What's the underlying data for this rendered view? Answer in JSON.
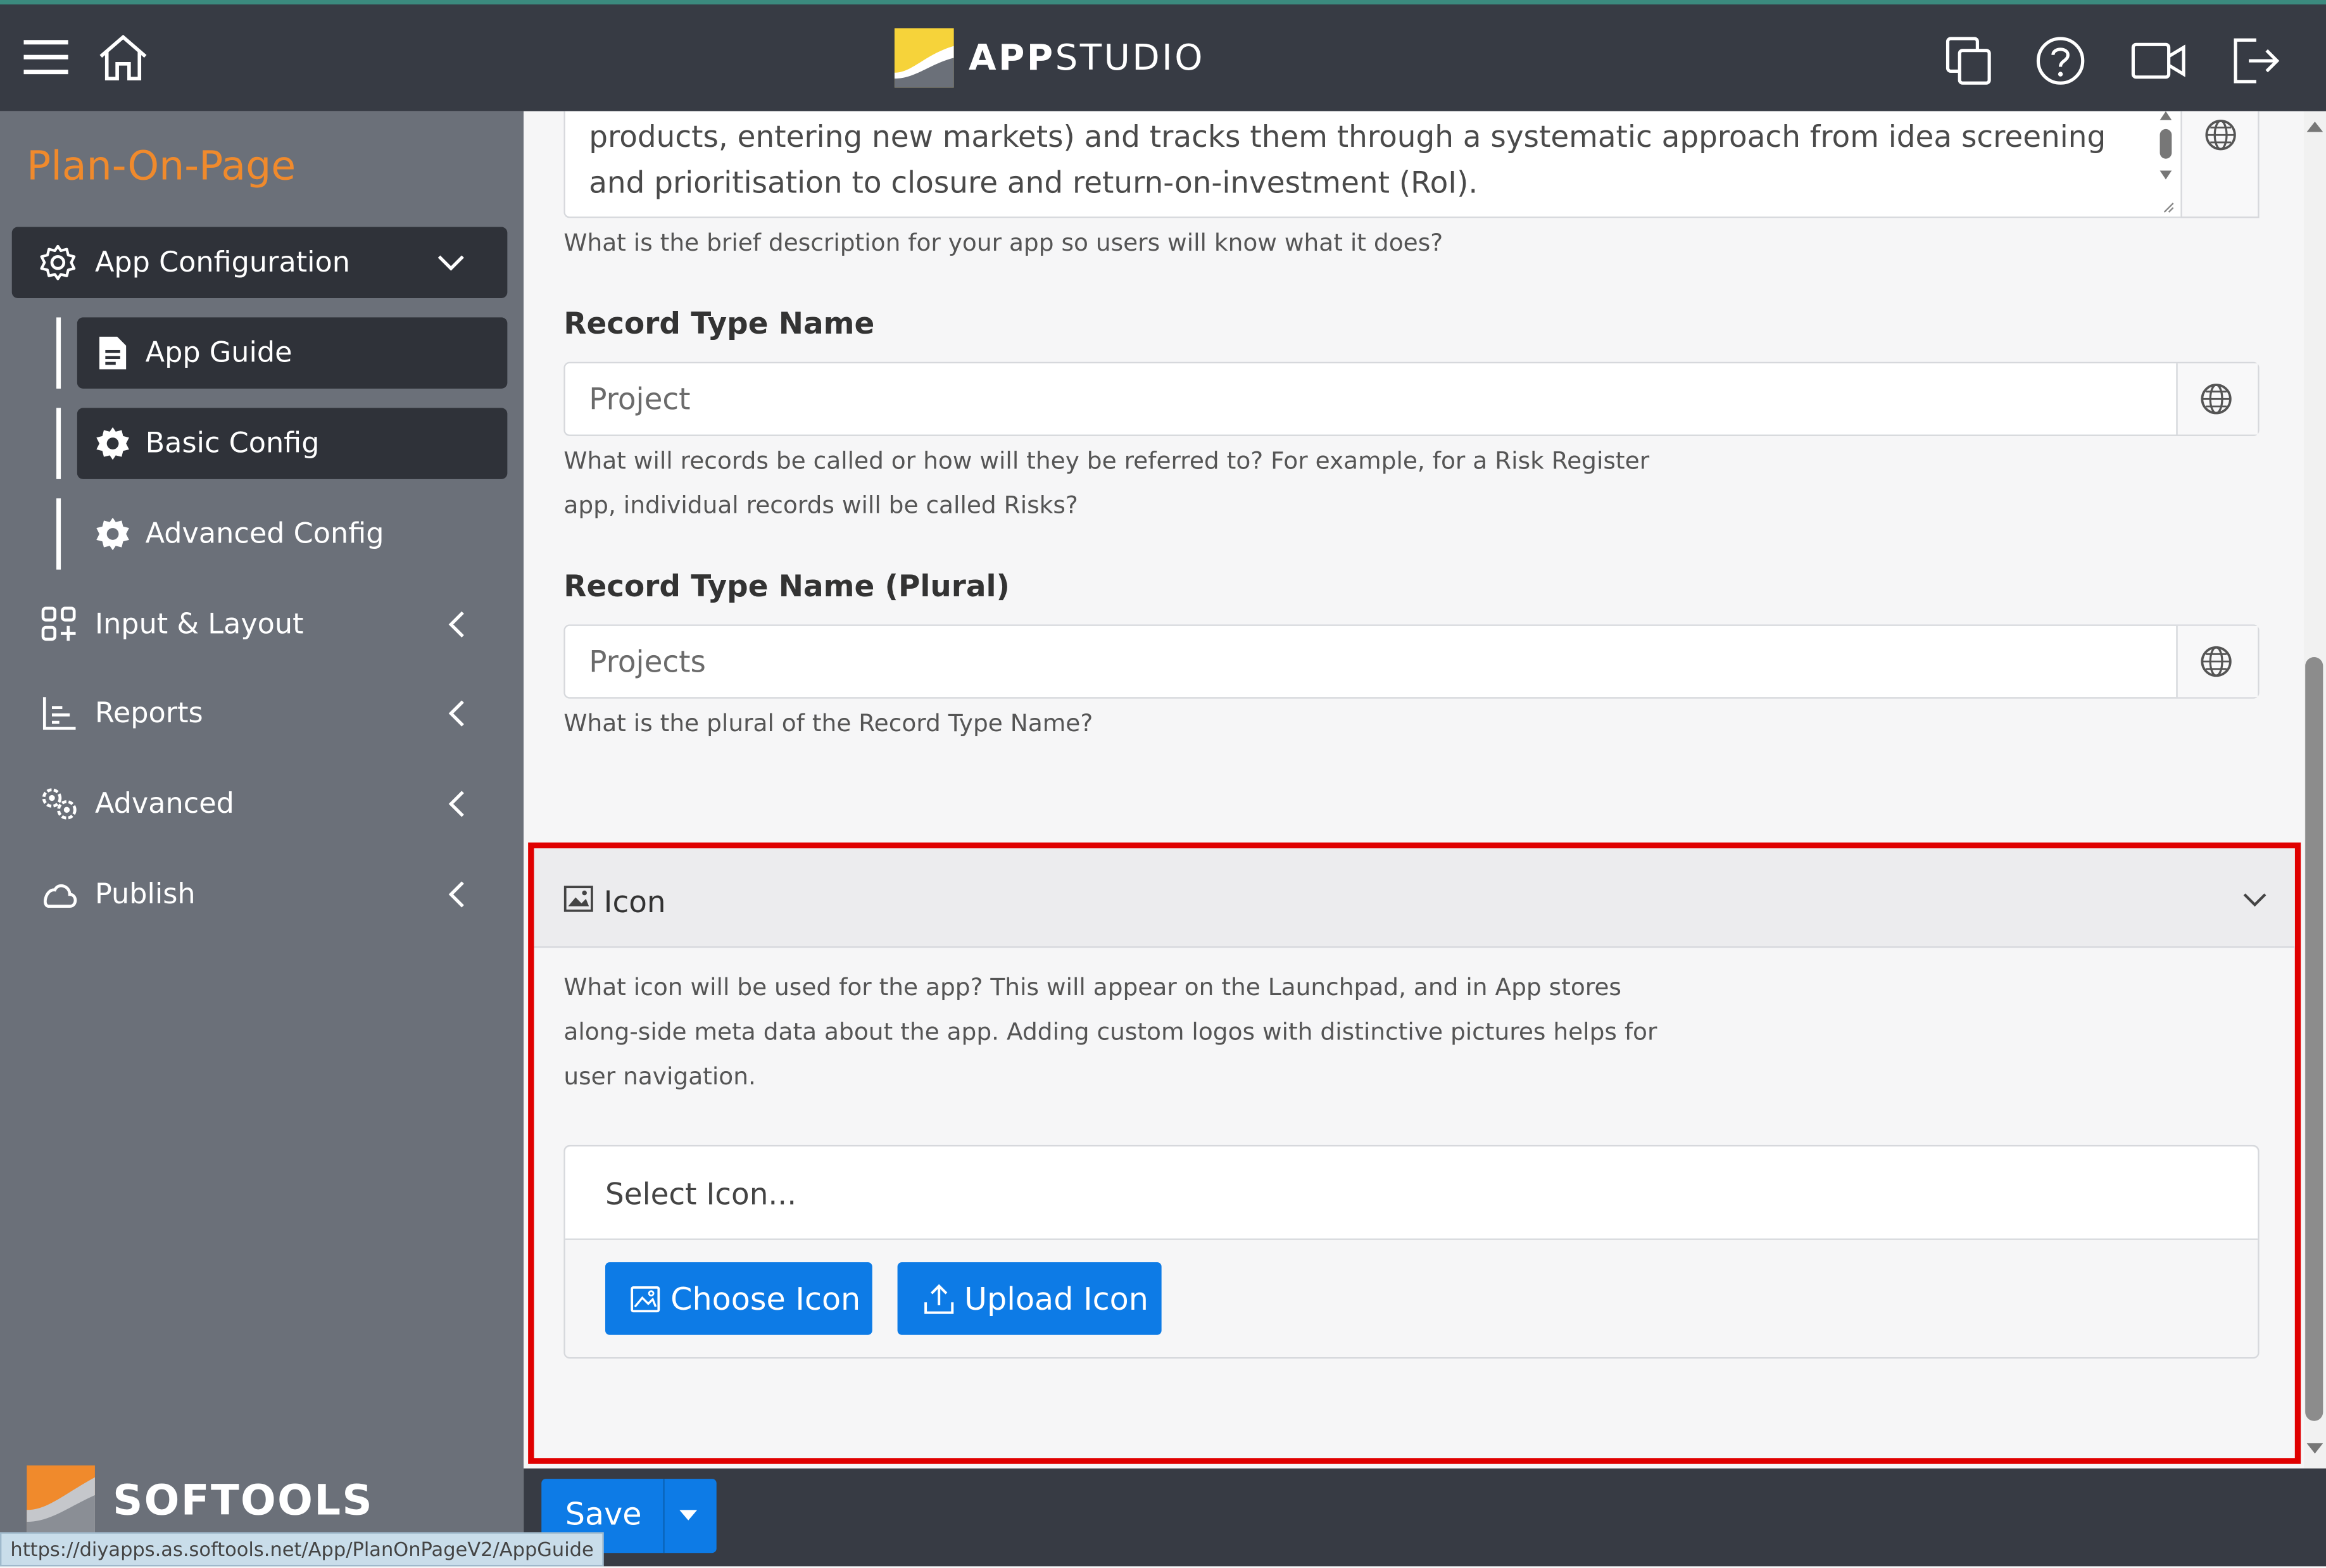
{
  "topbar": {
    "brand_bold": "APP",
    "brand_light": "STUDIO",
    "icons": [
      "menu-icon",
      "home-icon",
      "copy-icon",
      "help-icon",
      "video-icon",
      "logout-icon"
    ]
  },
  "sidebar": {
    "app_title": "Plan-On-Page",
    "items": [
      {
        "label": "App Configuration",
        "icon": "gear-outline-icon",
        "expanded": true
      },
      {
        "label": "App Guide",
        "icon": "document-icon"
      },
      {
        "label": "Basic Config",
        "icon": "cog-icon"
      },
      {
        "label": "Advanced Config",
        "icon": "cog-icon"
      },
      {
        "label": "Input & Layout",
        "icon": "grid-plus-icon"
      },
      {
        "label": "Reports",
        "icon": "chart-icon"
      },
      {
        "label": "Advanced",
        "icon": "gears-icon"
      },
      {
        "label": "Publish",
        "icon": "cloud-icon"
      }
    ],
    "footer_brand": "SOFTOOLS"
  },
  "form": {
    "description_text": "products, entering new markets) and tracks them through a systematic approach from idea screening and prioritisation to closure and return-on-investment (RoI).",
    "description_help": "What is the brief description for your app so users will know what it does?",
    "record_type_label": "Record Type Name",
    "record_type_value": "Project",
    "record_type_help_1": "What will records be called or how will they be referred to? For example, for a Risk Register",
    "record_type_help_2": "app, individual records will be called Risks?",
    "record_plural_label": "Record Type Name (Plural)",
    "record_plural_value": "Projects",
    "record_plural_help": "What is the plural of the Record Type Name?"
  },
  "icon_panel": {
    "title": "Icon",
    "help_1": "What icon will be used for the app? This will appear on the Launchpad, and in App stores",
    "help_2": "along-side meta data about the app. Adding custom logos with distinctive pictures helps for",
    "help_3": "user navigation.",
    "select_placeholder": "Select Icon...",
    "choose_label": "Choose Icon",
    "upload_label": "Upload Icon"
  },
  "footer": {
    "save_label": "Save",
    "status_url": "https://diyapps.as.softools.net/App/PlanOnPageV2/AppGuide"
  },
  "colors": {
    "accent": "#0d7be6",
    "app_title": "#f08a2c",
    "highlight": "#e00000",
    "topbar": "#373b44",
    "sidebar": "#6b7079"
  }
}
